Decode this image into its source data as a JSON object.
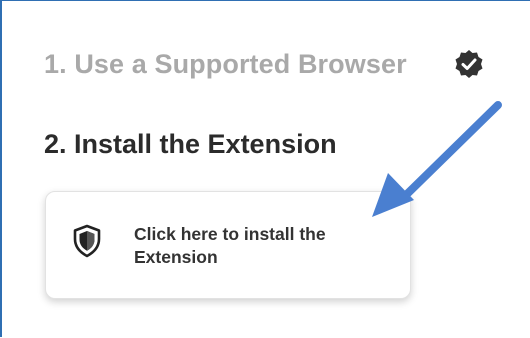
{
  "steps": {
    "step1": {
      "label": "1. Use a Supported Browser",
      "status_icon": "check-badge-icon",
      "completed": true
    },
    "step2": {
      "label": "2. Install the Extension"
    }
  },
  "install_card": {
    "icon": "shield-icon",
    "label": "Click here to install the Extension"
  },
  "annotation": {
    "icon": "pointer-arrow",
    "color": "#4a7fd0"
  },
  "colors": {
    "completed_text": "#a9a9a9",
    "heading_text": "#2b2b2b",
    "frame_border": "#2f6fb3"
  }
}
